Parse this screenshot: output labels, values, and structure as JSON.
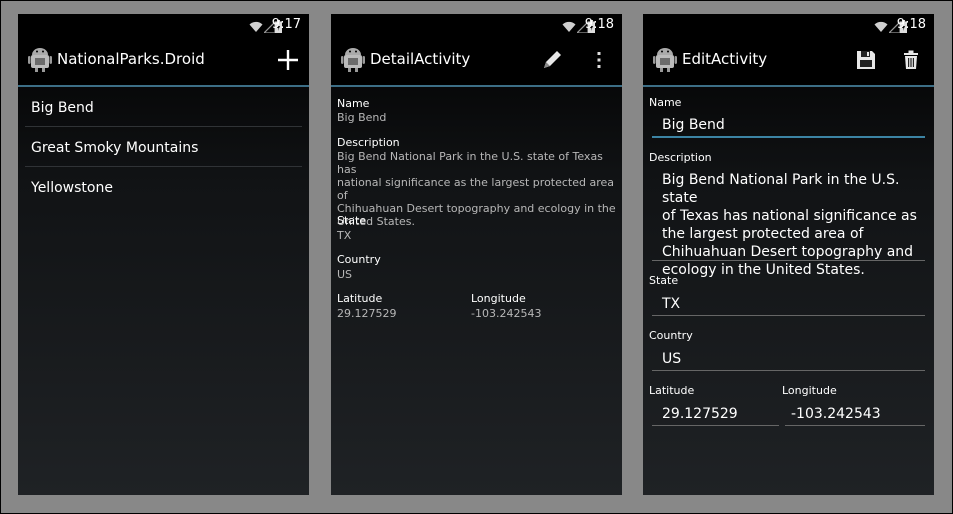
{
  "status_bar": {
    "screens": [
      {
        "time": "9:17"
      },
      {
        "time": "9:18"
      },
      {
        "time": "9:18"
      }
    ],
    "icons": [
      "wifi-icon",
      "signal-icon",
      "battery-icon"
    ]
  },
  "list_screen": {
    "title": "NationalParks.Droid",
    "actions": [
      "add-icon"
    ],
    "items": [
      {
        "label": "Big Bend"
      },
      {
        "label": "Great Smoky Mountains"
      },
      {
        "label": "Yellowstone"
      }
    ]
  },
  "detail_screen": {
    "title": "DetailActivity",
    "actions": [
      "edit-pencil-icon",
      "overflow-menu-icon"
    ],
    "name_label": "Name",
    "name_value": "Big Bend",
    "description_label": "Description",
    "description_lines": [
      "Big Bend National Park in the U.S. state of Texas has",
      "national significance as the largest protected area of",
      "Chihuahuan Desert topography and ecology in the",
      "United States."
    ],
    "state_label": "State",
    "state_value": "TX",
    "country_label": "Country",
    "country_value": "US",
    "latitude_label": "Latitude",
    "latitude_value": "29.127529",
    "longitude_label": "Longitude",
    "longitude_value": "-103.242543"
  },
  "edit_screen": {
    "title": "EditActivity",
    "actions": [
      "save-icon",
      "delete-icon"
    ],
    "name_label": "Name",
    "name_value": "Big Bend",
    "description_label": "Description",
    "description_lines": [
      "Big Bend National Park in the U.S. state",
      "of Texas has national significance as",
      "the largest protected area of",
      "Chihuahuan Desert topography and",
      "ecology in the United States."
    ],
    "state_label": "State",
    "state_value": "TX",
    "country_label": "Country",
    "country_value": "US",
    "latitude_label": "Latitude",
    "latitude_value": "29.127529",
    "longitude_label": "Longitude",
    "longitude_value": "-103.242543"
  },
  "colors": {
    "accent": "#3c6e86",
    "background": "#888888"
  }
}
